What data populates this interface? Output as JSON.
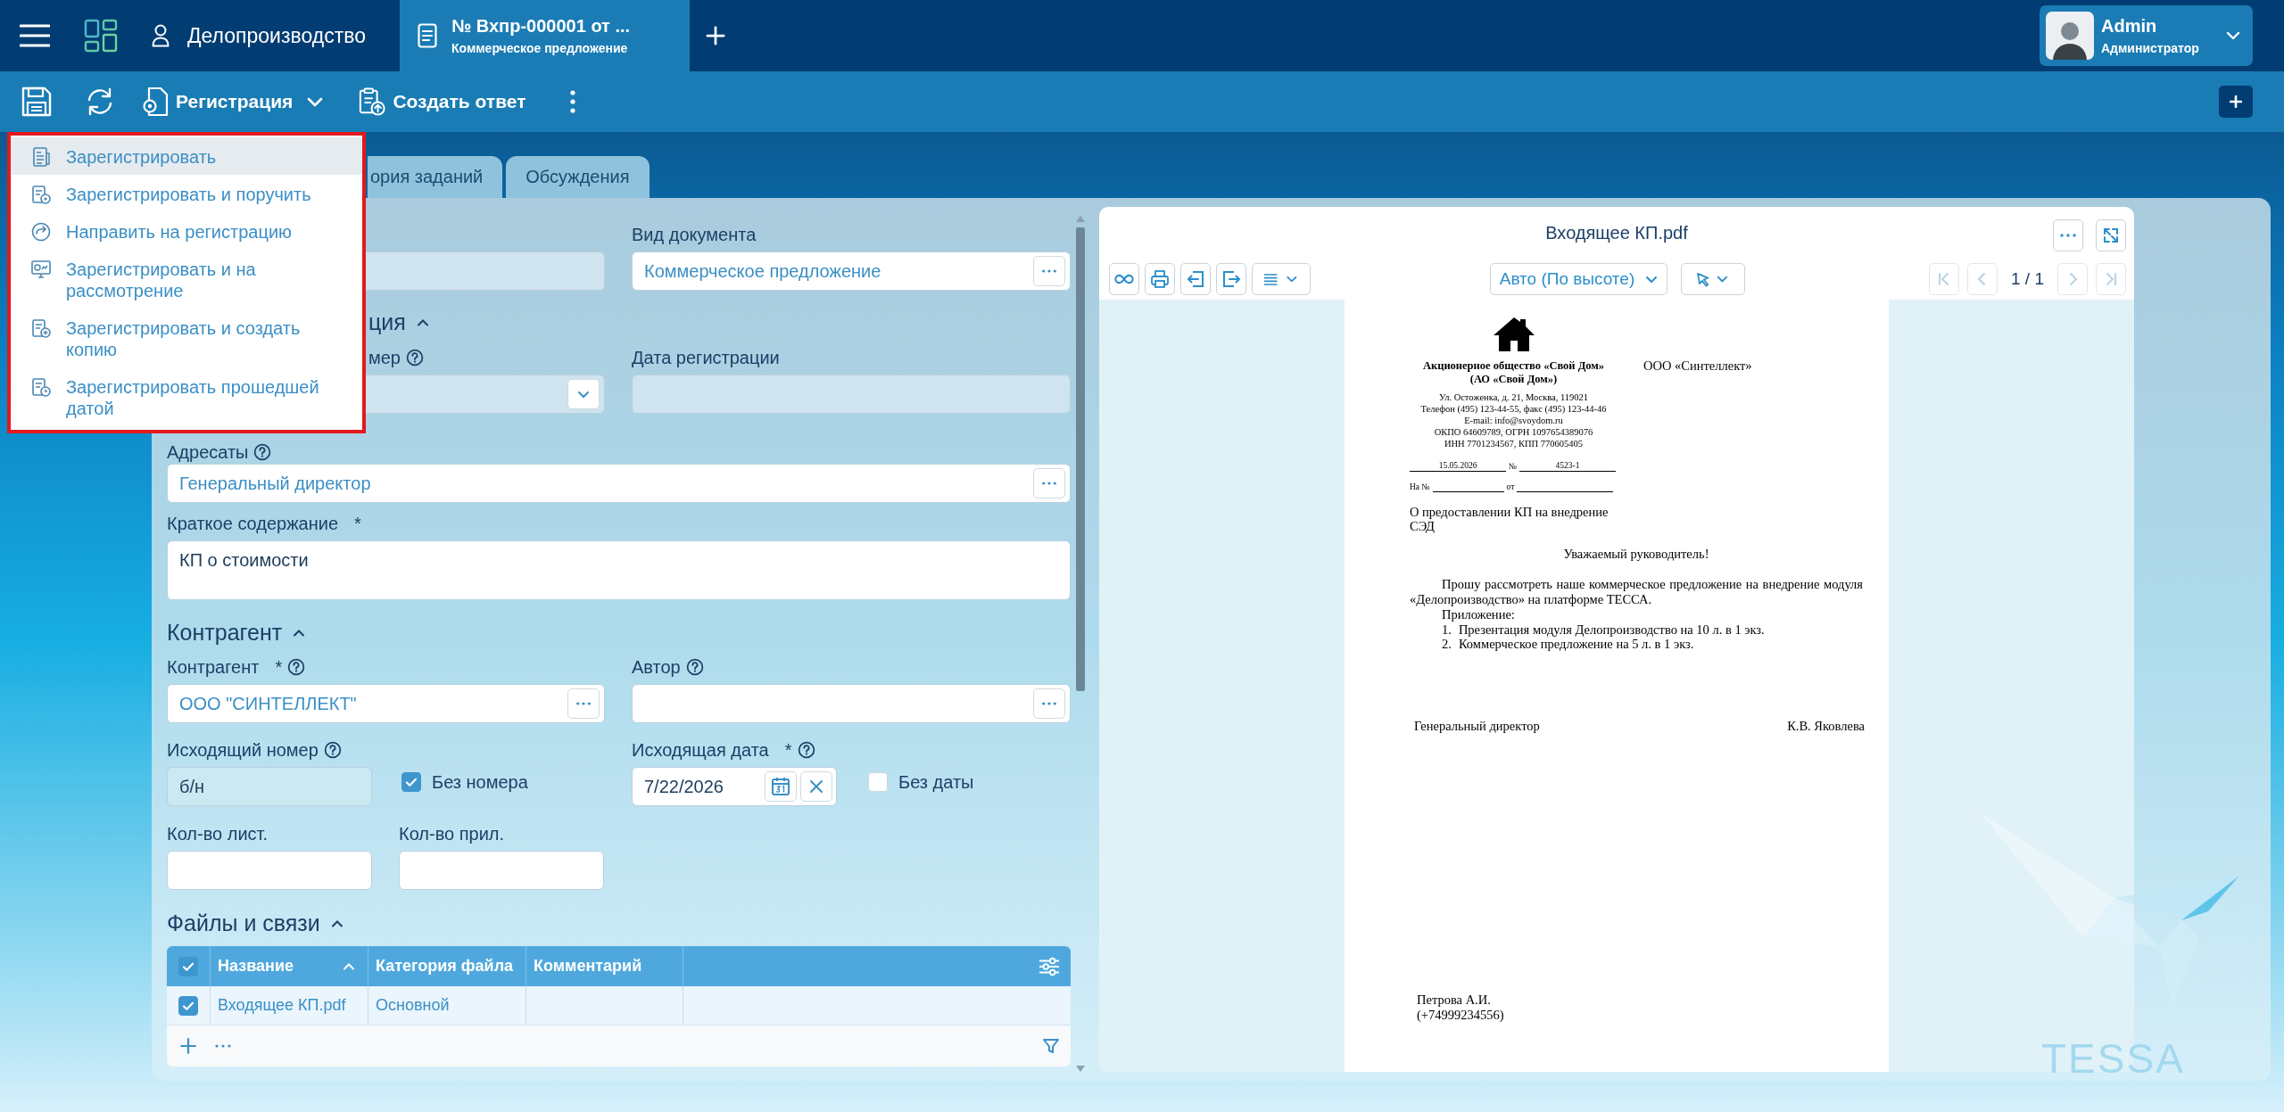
{
  "header": {
    "module": "Делопроизводство",
    "tabs": [
      {
        "title": "№ Вхпр-000001 от ...",
        "subtitle": "Коммерческое предложение",
        "selected": true
      }
    ],
    "user": {
      "name": "Admin",
      "role": "Администратор"
    }
  },
  "toolbar": {
    "registration": "Регистрация",
    "create_reply": "Создать ответ"
  },
  "registration_menu": [
    {
      "label": "Зарегистрировать",
      "selected": true
    },
    {
      "label": "Зарегистрировать и поручить",
      "selected": false
    },
    {
      "label": "Направить на регистрацию",
      "selected": false
    },
    {
      "label": "Зарегистрировать и на рассмотрение",
      "selected": false
    },
    {
      "label": "Зарегистрировать и создать копию",
      "selected": false
    },
    {
      "label": "Зарегистрировать прошедшей датой",
      "selected": false
    }
  ],
  "card_tabs": [
    {
      "label": "ория заданий",
      "selected": false
    },
    {
      "label": "Обсуждения",
      "selected": false
    }
  ],
  "form": {
    "document_kind": {
      "label": "Вид документа",
      "value": "Коммерческое предложение"
    },
    "document_number": {
      "readonly": true
    },
    "registration_section": {
      "title": "ция",
      "expanded": true
    },
    "registration_number": {
      "label": "мер",
      "help": true,
      "readonly": true
    },
    "registration_date": {
      "label": "Дата регистрации",
      "readonly": true
    },
    "addressees": {
      "label": "Адресаты",
      "help": true,
      "value": "Генеральный директор"
    },
    "summary": {
      "label": "Краткое содержание",
      "required_mark": "*",
      "value": "КП о стоимости"
    },
    "counterparty_section": {
      "title": "Контрагент",
      "expanded": true
    },
    "counterparty": {
      "label": "Контрагент",
      "required_mark": "*",
      "help": true,
      "value": "ООО \"СИНТЕЛЛЕКТ\""
    },
    "author": {
      "label": "Автор",
      "help": true
    },
    "outgoing_number": {
      "label": "Исходящий номер",
      "help": true,
      "value": "б/н",
      "readonly": true
    },
    "no_number": {
      "label": "Без номера",
      "checked": true
    },
    "outgoing_date": {
      "label": "Исходящая дата",
      "required_mark": "*",
      "help": true,
      "value": "7/22/2026"
    },
    "no_date": {
      "label": "Без даты",
      "checked": false
    },
    "sheet_count": {
      "label": "Кол-во лист."
    },
    "attachment_count": {
      "label": "Кол-во прил."
    },
    "files_section": {
      "title": "Файлы и связи",
      "expanded": true
    },
    "files_table": {
      "all_checked": true,
      "columns": [
        {
          "label": "Название",
          "sorted": true
        },
        {
          "label": "Категория файла",
          "sorted": false
        },
        {
          "label": "Комментарий",
          "sorted": false
        }
      ],
      "rows": [
        {
          "name": "Входящее КП.pdf",
          "category": "Основной",
          "checked": true
        }
      ]
    }
  },
  "viewer": {
    "title": "Входящее КП.pdf",
    "zoom_mode": "Авто (По высоте)",
    "page_indicator": "1 / 1",
    "nav": [
      {
        "disabled": true
      },
      {
        "disabled": true
      },
      {
        "disabled": true
      },
      {
        "disabled": true
      }
    ],
    "document": {
      "org_name": "Акционерное общество «Свой Дом»",
      "org_short": "(АО «Свой Дом»)",
      "org_details": [
        "Ул. Остоженка, д. 21, Москва, 119021",
        "Телефон (495) 123-44-55, факс (495) 123-44-46",
        "E-mail: info@svoydom.ru",
        "ОКПО 64609789, ОГРН 1097654389076",
        "ИНН 7701234567, КПП 770605405"
      ],
      "recipient": "ООО «Синтеллект»",
      "date": "15.05.2026",
      "number_label": "№",
      "number": "4523-1",
      "ref_number_label": "На №",
      "ref_date_label": "от",
      "subject": "О предоставлении КП на внедрение СЭД",
      "greeting": "Уважаемый руководитель!",
      "body": "Прошу рассмотреть наше коммерческое предложение на внедрение модуля «Делопроизводство» на платформе ТЕССА.",
      "attachments_title": "Приложение:",
      "attachments": [
        {
          "number": "1.",
          "text": "Презентация модуля Делопроизводство на 10 л. в 1 экз."
        },
        {
          "number": "2.",
          "text": "Коммерческое предложение на 5 л. в 1 экз."
        }
      ],
      "signer_position": "Генеральный директор",
      "signer_name": "К.В. Яковлева",
      "executor": "Петрова А.И.",
      "executor_phone": "(+74999234556)"
    }
  },
  "brand": "TESSA"
}
